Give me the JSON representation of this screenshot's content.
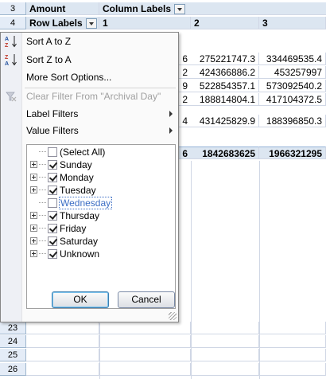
{
  "pivot": {
    "title": "Amount",
    "column_labels": "Column Labels",
    "row_labels": "Row Labels",
    "col_headers": [
      "1",
      "2",
      "3"
    ],
    "rows": [
      {
        "c1": "6",
        "c2": "275221747.3",
        "c3": "334469535.4"
      },
      {
        "c1": "2",
        "c2": "424366886.2",
        "c3": "453257997"
      },
      {
        "c1": "9",
        "c2": "522854357.1",
        "c3": "573092540.2"
      },
      {
        "c1": "2",
        "c2": "188814804.1",
        "c3": "417104372.5"
      },
      {
        "c1": "4",
        "c2": "431425829.9",
        "c3": "188396850.3"
      }
    ],
    "total": {
      "c1": "6",
      "c2": "1842683625",
      "c3": "1966321295"
    }
  },
  "row_numbers": {
    "r3": "3",
    "r4": "4",
    "r23": "23",
    "r24": "24",
    "r25": "25",
    "r26": "26"
  },
  "menu": {
    "sort_az": "Sort A to Z",
    "sort_za": "Sort Z to A",
    "more_sort": "More Sort Options...",
    "clear_filter": "Clear Filter From \"Archival Day\"",
    "label_filters": "Label Filters",
    "value_filters": "Value Filters"
  },
  "filter_list": [
    {
      "label": "(Select All)",
      "checked": false,
      "expandable": false
    },
    {
      "label": "Sunday",
      "checked": true,
      "expandable": true
    },
    {
      "label": "Monday",
      "checked": true,
      "expandable": true
    },
    {
      "label": "Tuesday",
      "checked": true,
      "expandable": true
    },
    {
      "label": "Wednesday",
      "checked": false,
      "expandable": false
    },
    {
      "label": "Thursday",
      "checked": true,
      "expandable": true
    },
    {
      "label": "Friday",
      "checked": true,
      "expandable": true
    },
    {
      "label": "Saturday",
      "checked": true,
      "expandable": true
    },
    {
      "label": "Unknown",
      "checked": true,
      "expandable": true
    }
  ],
  "buttons": {
    "ok": "OK",
    "cancel": "Cancel"
  },
  "icons": {
    "sort_az": "sort-ascending-icon",
    "sort_za": "sort-descending-icon",
    "clear_filter": "clear-filter-icon"
  },
  "colors": {
    "header_fill": "#dce6f1",
    "rownum_fill": "#e4ecf7",
    "selection_outline": "#3c6ec4"
  }
}
